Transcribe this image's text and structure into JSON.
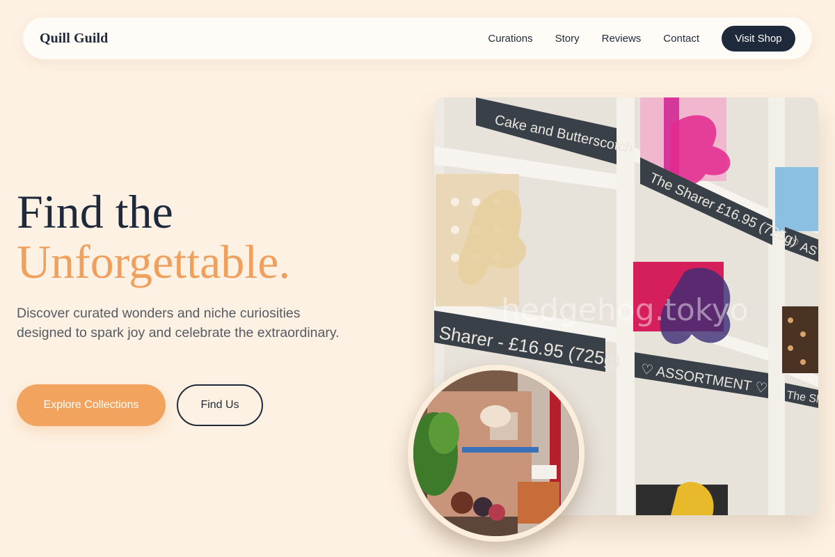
{
  "nav": {
    "brand": "Quill Guild",
    "links": [
      "Curations",
      "Story",
      "Reviews",
      "Contact"
    ],
    "cta": "Visit Shop"
  },
  "hero": {
    "title_line1": "Find the",
    "title_line2": "Unforgettable.",
    "description": "Discover curated wonders and niche curiosities designed to spark joy and celebrate the extraordinary.",
    "primary_button": "Explore Collections",
    "secondary_button": "Find Us"
  },
  "images": {
    "main": {
      "signs": [
        "Cake and Butterscotch",
        "The Sharer £16.95 (725g)",
        "Sharer - £16.95 (725g)",
        "♡ ASSORTMENT ♡",
        "♡ AS",
        "The Sh"
      ],
      "watermark": "hedgehog.tokyo"
    },
    "inset": {}
  },
  "colors": {
    "background": "#fdf1e3",
    "navy": "#1e2a3b",
    "accent": "#f0a05c"
  }
}
